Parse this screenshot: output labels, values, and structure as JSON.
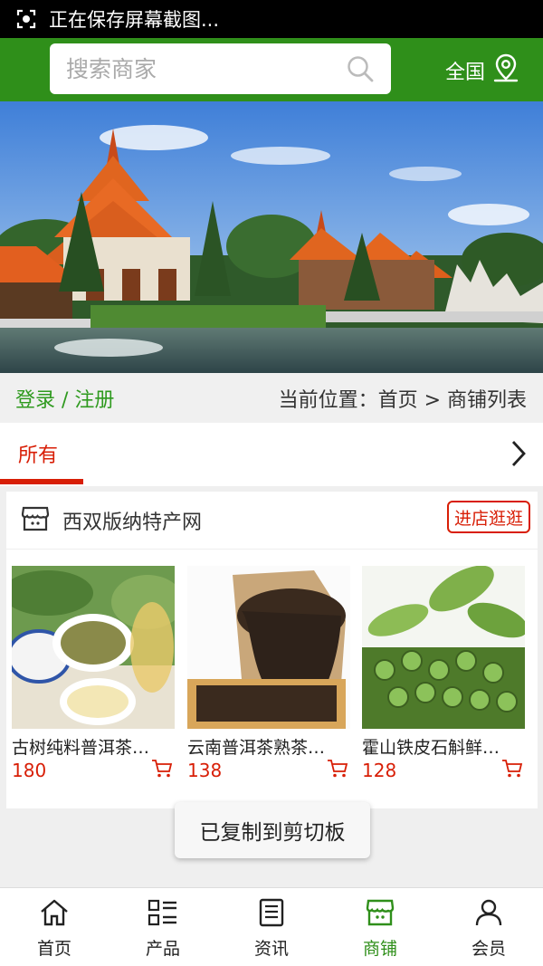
{
  "status_bar": {
    "text": "正在保存屏幕截图..."
  },
  "header": {
    "search_placeholder": "搜索商家",
    "region_label": "全国",
    "icons": {
      "search": "search-icon",
      "location": "location-pin-icon"
    }
  },
  "breadcrumb": {
    "login_label": "登录 / 注册",
    "location_text": "当前位置：首页 > 商铺列表"
  },
  "tabs": {
    "active_label": "所有",
    "more_icon": "chevron-right-icon"
  },
  "shop": {
    "name": "西双版纳特产网",
    "visit_label": "进店逛逛",
    "icon": "store-icon",
    "products": [
      {
        "name": "古树纯料普洱茶…",
        "price": "180"
      },
      {
        "name": "云南普洱茶熟茶…",
        "price": "138"
      },
      {
        "name": "霍山铁皮石斛鲜…",
        "price": "128"
      }
    ]
  },
  "toast": {
    "text": "已复制到剪切板"
  },
  "bottom_nav": {
    "items": [
      {
        "label": "首页",
        "icon": "home-icon"
      },
      {
        "label": "产品",
        "icon": "grid-list-icon"
      },
      {
        "label": "资讯",
        "icon": "news-icon"
      },
      {
        "label": "商铺",
        "icon": "store-icon",
        "active": true
      },
      {
        "label": "会员",
        "icon": "user-icon"
      }
    ]
  },
  "colors": {
    "brand_green": "#2f8f1a",
    "accent_red": "#d81e06",
    "link_green": "#2f9a1f"
  }
}
